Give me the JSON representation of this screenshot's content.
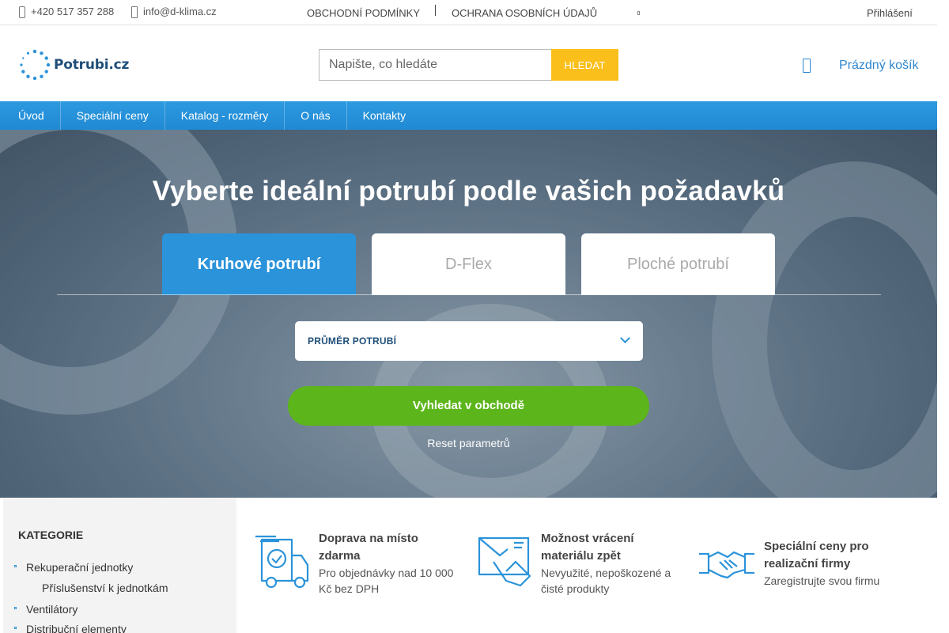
{
  "topbar": {
    "phone": "+420 517 357 288",
    "email": "info@d-klima.cz",
    "links": [
      "OBCHODNÍ PODMÍNKY",
      "OCHRANA OSOBNÍCH ÚDAJŮ"
    ],
    "login": "Přihlášení"
  },
  "header": {
    "logo_text": "Potrubi.cz",
    "search_placeholder": "Napište, co hledáte",
    "search_button": "HLEDAT",
    "cart_label": "Prázdný košík"
  },
  "nav": {
    "items": [
      "Úvod",
      "Speciální ceny",
      "Katalog - rozměry",
      "O nás",
      "Kontakty"
    ]
  },
  "hero": {
    "title": "Vyberte ideální potrubí podle vašich požadavků",
    "tabs": [
      "Kruhové potrubí",
      "D-Flex",
      "Ploché potrubí"
    ],
    "active_tab": "Kruhové potrubí",
    "select_label": "PRŮMĚR POTRUBÍ",
    "search_button": "Vyhledat v obchodě",
    "reset": "Reset parametrů"
  },
  "sidebar": {
    "title": "KATEGORIE",
    "categories": [
      "Rekuperační jednotky",
      "Příslušenství k jednotkám",
      "Ventilátory",
      "Distribuční elementy"
    ]
  },
  "features": [
    {
      "title": "Doprava na místo zdarma",
      "subtitle": "Pro objednávky nad 10 000 Kč bez DPH"
    },
    {
      "title": "Možnost vrácení materiálu zpět",
      "subtitle": "Nevyužité, nepoškozené a čisté produkty"
    },
    {
      "title": "Speciální ceny pro realizační firmy",
      "subtitle": "Zaregistrujte svou firmu"
    }
  ],
  "colors": {
    "brand_blue": "#2b93da",
    "search_yellow": "#fbbf1c",
    "cta_green": "#5cb51a",
    "logo_navy": "#1f4f79"
  }
}
